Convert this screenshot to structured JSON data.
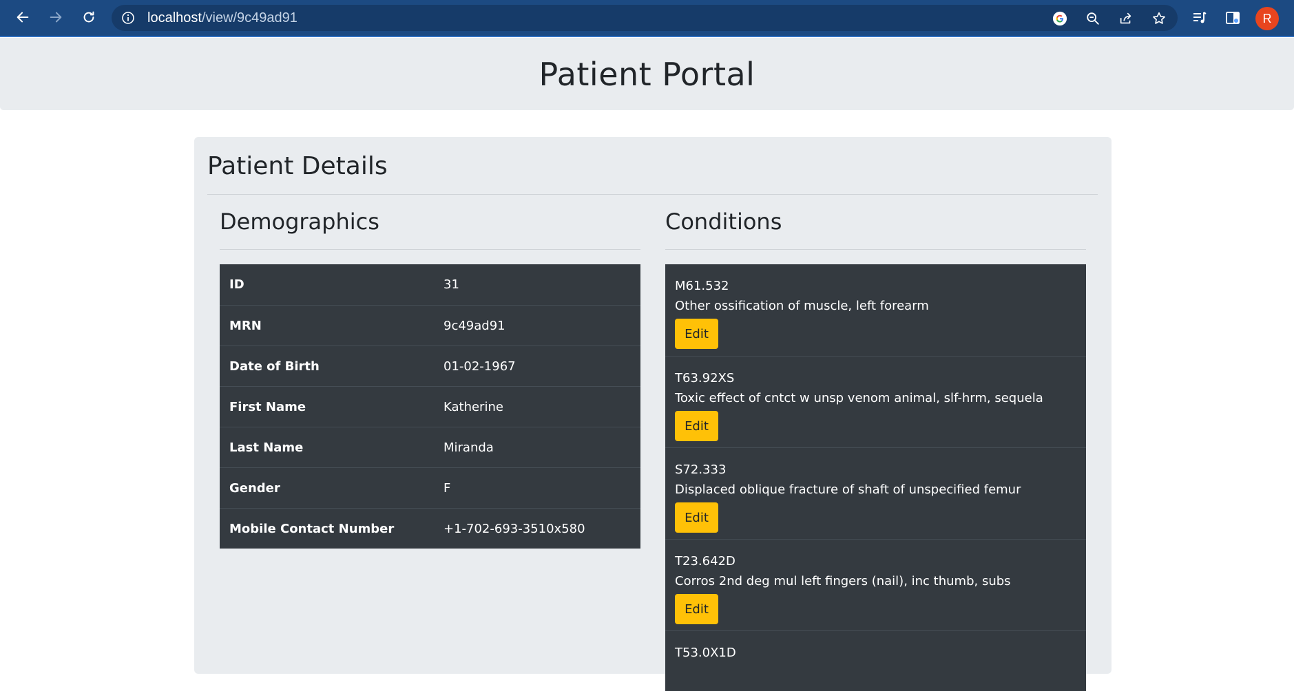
{
  "browser": {
    "url_host": "localhost",
    "url_path": "/view/9c49ad91",
    "profile_initial": "R"
  },
  "page": {
    "portal_title": "Patient Portal",
    "card_title": "Patient Details"
  },
  "demographics": {
    "title": "Demographics",
    "rows": [
      {
        "label": "ID",
        "value": "31"
      },
      {
        "label": "MRN",
        "value": "9c49ad91"
      },
      {
        "label": "Date of Birth",
        "value": "01-02-1967"
      },
      {
        "label": "First Name",
        "value": "Katherine"
      },
      {
        "label": "Last Name",
        "value": "Miranda"
      },
      {
        "label": "Gender",
        "value": "F"
      },
      {
        "label": "Mobile Contact Number",
        "value": "+1-702-693-3510x580"
      }
    ]
  },
  "conditions": {
    "title": "Conditions",
    "edit_label": "Edit",
    "items": [
      {
        "code": "M61.532",
        "description": "Other ossification of muscle, left forearm"
      },
      {
        "code": "T63.92XS",
        "description": "Toxic effect of cntct w unsp venom animal, slf-hrm, sequela"
      },
      {
        "code": "S72.333",
        "description": "Displaced oblique fracture of shaft of unspecified femur"
      },
      {
        "code": "T23.642D",
        "description": "Corros 2nd deg mul left fingers (nail), inc thumb, subs"
      },
      {
        "code": "T53.0X1D",
        "description": ""
      }
    ]
  },
  "colors": {
    "chrome": "#1c4a82",
    "table_bg": "#343a40",
    "edit_button": "#ffc107",
    "card_bg": "#e9ecef"
  }
}
